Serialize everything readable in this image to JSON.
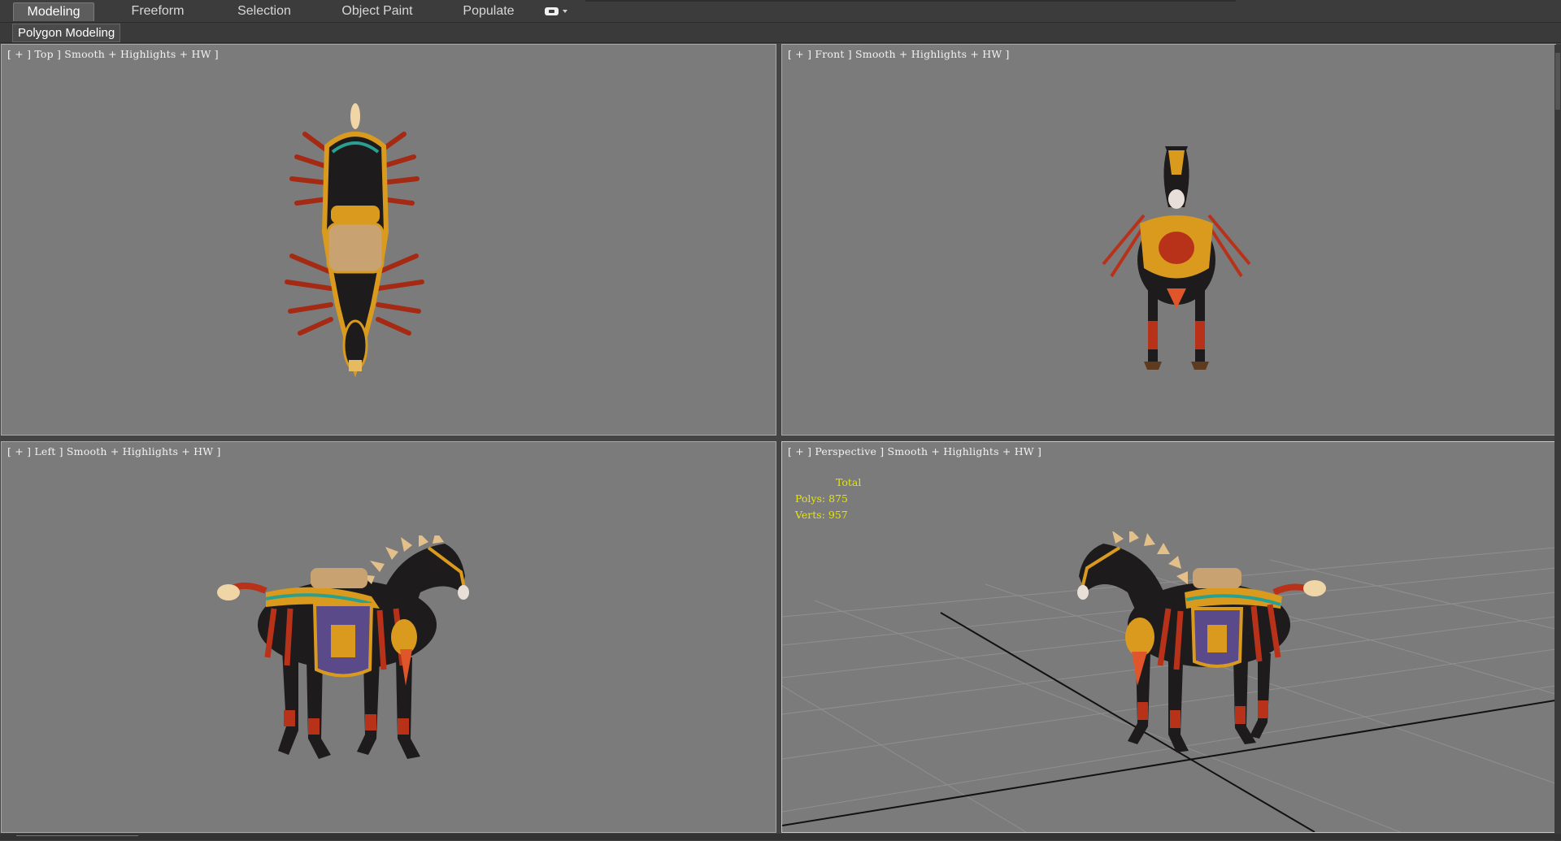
{
  "ribbon": {
    "tabs": [
      {
        "label": "Modeling",
        "active": true
      },
      {
        "label": "Freeform",
        "active": false
      },
      {
        "label": "Selection",
        "active": false
      },
      {
        "label": "Object Paint",
        "active": false
      },
      {
        "label": "Populate",
        "active": false
      }
    ],
    "toggle_icon": "ribbon-minimize-icon",
    "panel_label": "Polygon Modeling"
  },
  "viewports": {
    "top": {
      "label": "[ + ] Top ] Smooth + Highlights + HW ]"
    },
    "front": {
      "label": "[ + ] Front ] Smooth + Highlights + HW ]"
    },
    "left": {
      "label": "[ + ] Left ] Smooth + Highlights + HW ]"
    },
    "perspective": {
      "label": "[ + ] Perspective ] Smooth + Highlights + HW ]",
      "stats": {
        "total": "Total",
        "polys": "Polys: 875",
        "verts": "Verts: 957"
      }
    }
  },
  "colors": {
    "viewport_bg": "#7b7b7b",
    "stats_text": "#e6e600",
    "horse_body": "#1d1b1c",
    "armor_gold": "#d99a1e",
    "armor_red": "#b8321a"
  }
}
